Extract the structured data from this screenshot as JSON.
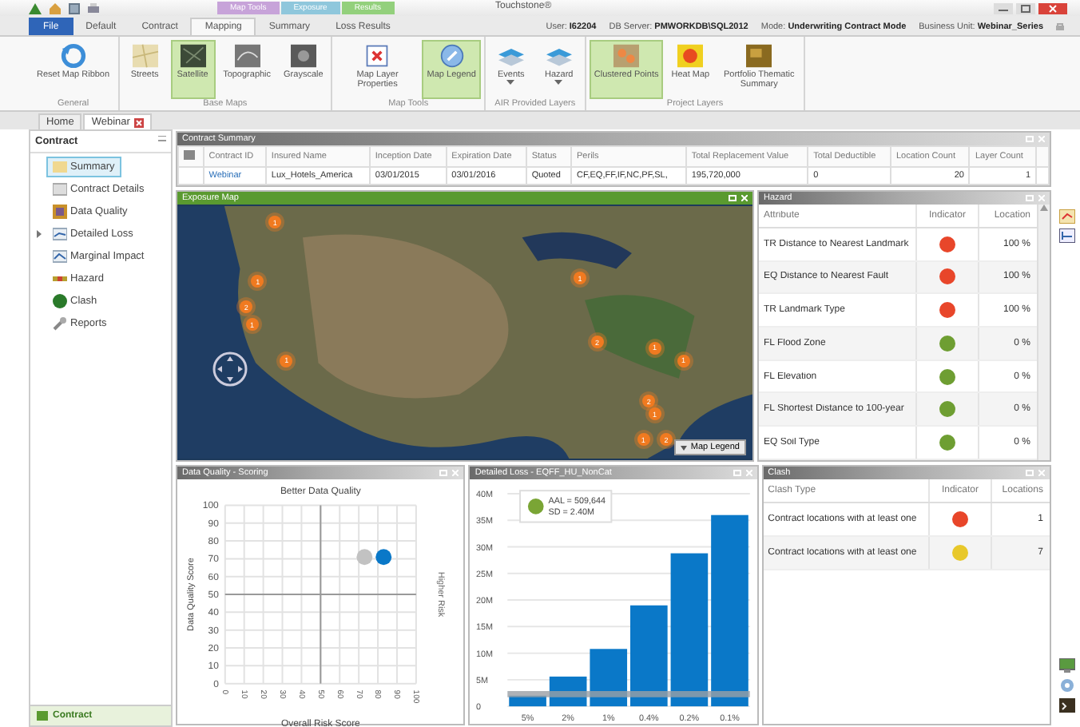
{
  "window": {
    "title": "Touchstone®"
  },
  "context_tabs": [
    {
      "label": "Map Tools",
      "color": "#c7a3d9"
    },
    {
      "label": "Exposure",
      "color": "#8fc7dc"
    },
    {
      "label": "Results",
      "color": "#93d07c"
    }
  ],
  "ribbon_tabs": [
    {
      "label": "File",
      "selected": false,
      "kind": "file"
    },
    {
      "label": "Default",
      "selected": false,
      "kind": "tab"
    },
    {
      "label": "Contract",
      "selected": false,
      "kind": "tab"
    },
    {
      "label": "Mapping",
      "selected": true,
      "kind": "tab"
    },
    {
      "label": "Summary",
      "selected": false,
      "kind": "tab"
    },
    {
      "label": "Loss Results",
      "selected": false,
      "kind": "tab"
    }
  ],
  "session_info": [
    {
      "label": "User:",
      "value": "I62204"
    },
    {
      "label": "DB Server:",
      "value": "PMWORKDB\\SQL2012"
    },
    {
      "label": "Mode:",
      "value": "Underwriting Contract Mode"
    },
    {
      "label": "Business Unit:",
      "value": "Webinar_Series"
    }
  ],
  "ribbon_groups": [
    {
      "label": "General",
      "buttons": [
        {
          "label": "Reset Map Ribbon",
          "selected": false,
          "dropdown": false
        }
      ]
    },
    {
      "label": "Base Maps",
      "buttons": [
        {
          "label": "Streets",
          "selected": false,
          "dropdown": false
        },
        {
          "label": "Satellite",
          "selected": true,
          "dropdown": false
        },
        {
          "label": "Topographic",
          "selected": false,
          "dropdown": false
        },
        {
          "label": "Grayscale",
          "selected": false,
          "dropdown": false
        }
      ]
    },
    {
      "label": "Map Tools",
      "buttons": [
        {
          "label": "Map Layer Properties",
          "selected": false,
          "dropdown": false
        },
        {
          "label": "Map Legend",
          "selected": true,
          "dropdown": false
        }
      ]
    },
    {
      "label": "AIR Provided Layers",
      "buttons": [
        {
          "label": "Events",
          "selected": false,
          "dropdown": true
        },
        {
          "label": "Hazard",
          "selected": false,
          "dropdown": true
        }
      ]
    },
    {
      "label": "Project Layers",
      "buttons": [
        {
          "label": "Clustered Points",
          "selected": true,
          "dropdown": false
        },
        {
          "label": "Heat Map",
          "selected": false,
          "dropdown": false
        },
        {
          "label": "Portfolio Thematic Summary",
          "selected": false,
          "dropdown": false
        }
      ]
    }
  ],
  "document_tabs": [
    {
      "label": "Home",
      "selected": false,
      "closable": false
    },
    {
      "label": "Webinar",
      "selected": true,
      "closable": true
    }
  ],
  "sidebar": {
    "title": "Contract",
    "items": [
      {
        "label": "Summary",
        "selected": true,
        "expandable": false
      },
      {
        "label": "Contract Details",
        "selected": false,
        "expandable": false
      },
      {
        "label": "Data Quality",
        "selected": false,
        "expandable": false
      },
      {
        "label": "Detailed Loss",
        "selected": false,
        "expandable": true
      },
      {
        "label": "Marginal Impact",
        "selected": false,
        "expandable": false
      },
      {
        "label": "Hazard",
        "selected": false,
        "expandable": false
      },
      {
        "label": "Clash",
        "selected": false,
        "expandable": false
      },
      {
        "label": "Reports",
        "selected": false,
        "expandable": false
      }
    ],
    "footer": "Contract"
  },
  "contract_summary": {
    "title": "Contract Summary",
    "columns": [
      "Contract ID",
      "Insured Name",
      "Inception Date",
      "Expiration Date",
      "Status",
      "Perils",
      "Total Replacement Value",
      "Total Deductible",
      "Location Count",
      "Layer Count"
    ],
    "rows": [
      [
        "Webinar",
        "Lux_Hotels_America",
        "03/01/2015",
        "03/01/2016",
        "Quoted",
        "CF,EQ,FF,IF,NC,PF,SL,",
        "195,720,000",
        "0",
        "20",
        "1"
      ]
    ]
  },
  "exposure_map": {
    "title": "Exposure Map",
    "clusters": [
      {
        "label": "1"
      },
      {
        "label": "1"
      },
      {
        "label": "2"
      },
      {
        "label": "1"
      },
      {
        "label": "1"
      },
      {
        "label": "1"
      },
      {
        "label": "2"
      },
      {
        "label": "1"
      },
      {
        "label": "1"
      },
      {
        "label": "2"
      },
      {
        "label": "1"
      },
      {
        "label": "1"
      },
      {
        "label": "2"
      }
    ],
    "legend_button": "Map Legend"
  },
  "hazard": {
    "title": "Hazard",
    "columns": [
      "Attribute",
      "Indicator",
      "Location"
    ],
    "rows": [
      {
        "attribute": "TR Distance to Nearest Landmark",
        "color": "#e8462a",
        "location": "100 %"
      },
      {
        "attribute": "EQ Distance to Nearest Fault",
        "color": "#e8462a",
        "location": "100 %"
      },
      {
        "attribute": "TR Landmark Type",
        "color": "#e8462a",
        "location": "100 %"
      },
      {
        "attribute": "FL Flood Zone",
        "color": "#6e9e32",
        "location": "0 %"
      },
      {
        "attribute": "FL Elevation",
        "color": "#6e9e32",
        "location": "0 %"
      },
      {
        "attribute": "FL Shortest Distance to 100-year",
        "color": "#6e9e32",
        "location": "0 %"
      },
      {
        "attribute": "EQ Soil Type",
        "color": "#6e9e32",
        "location": "0 %"
      }
    ]
  },
  "data_quality": {
    "title": "Data Quality - Scoring",
    "chart_data": {
      "type": "scatter",
      "title": "Better Data Quality",
      "xlabel": "Overall Risk Score",
      "ylabel": "Data Quality Score",
      "xlim": [
        0,
        100
      ],
      "ylim": [
        0,
        100
      ],
      "xticks": [
        0,
        10,
        20,
        30,
        40,
        50,
        60,
        70,
        80,
        90,
        100
      ],
      "yticks": [
        0,
        10,
        20,
        30,
        40,
        50,
        60,
        70,
        80,
        90,
        100
      ],
      "grid": true,
      "series": [
        {
          "color": "#c2c2c2",
          "x": [
            73
          ],
          "values": [
            71
          ]
        },
        {
          "color": "#0a78c8",
          "x": [
            83
          ],
          "values": [
            71
          ]
        }
      ],
      "annotations": [
        {
          "text": "Higher Risk"
        }
      ]
    }
  },
  "detailed_loss": {
    "title": "Detailed Loss - EQFF_HU_NonCat",
    "chart_data": {
      "type": "bar",
      "categories": [
        "5%",
        "2%",
        "1%",
        "0.4%",
        "0.2%",
        "0.1%"
      ],
      "ylim": [
        0,
        40
      ],
      "yticks": [
        {
          "value": 0,
          "label": "0"
        },
        {
          "value": 5,
          "label": "5M"
        },
        {
          "value": 10,
          "label": "10M"
        },
        {
          "value": 15,
          "label": "15M"
        },
        {
          "value": 20,
          "label": "20M"
        },
        {
          "value": 25,
          "label": "25M"
        },
        {
          "value": 30,
          "label": "30M"
        },
        {
          "value": 35,
          "label": "35M"
        },
        {
          "value": 40,
          "label": "40M"
        }
      ],
      "grid": true,
      "series": [
        {
          "color": "#0a78c8",
          "values": [
            2,
            5.6,
            10.8,
            19,
            28.8,
            36
          ]
        }
      ],
      "ref_lines": [
        {
          "axis": "y",
          "value": 2.3
        }
      ],
      "annotations": [
        {
          "text": "AAL = 509,644"
        },
        {
          "text": "SD = 2.40M"
        }
      ]
    }
  },
  "clash": {
    "title": "Clash",
    "columns": [
      "Clash Type",
      "Indicator",
      "Locations"
    ],
    "rows": [
      {
        "type": "Contract locations with at least one",
        "color": "#e8462a",
        "locations": "1"
      },
      {
        "type": "Contract locations with at least one",
        "color": "#e8c82a",
        "locations": "7"
      }
    ]
  }
}
